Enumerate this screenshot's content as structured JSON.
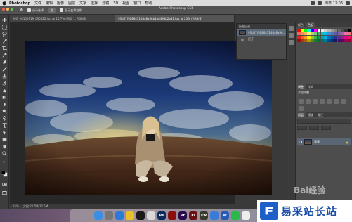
{
  "menubar": {
    "app_name": "Photoshop",
    "items": [
      "文件",
      "编辑",
      "图像",
      "图层",
      "文字",
      "选择",
      "滤镜",
      "3D",
      "视图",
      "窗口",
      "帮助"
    ],
    "clock": "周日 12:06"
  },
  "window": {
    "title": "Adobe Photoshop CS6"
  },
  "options_bar": {
    "auto_select_label": "自动选择:",
    "layer_select": "组",
    "show_transform_label": "显示变换控件"
  },
  "document_tabs": [
    {
      "label": "IMG_20150919_090522.jpg @ 16.7% (图层 1, RGB/8)",
      "active": false
    },
    {
      "label": "93d57f92864314da8a98b1a8494b2b31.jpg @ 25% (RGB/8)",
      "active": true
    }
  ],
  "status_bar": {
    "zoom": "25%",
    "doc_info": "文档:22.5M/22.5M"
  },
  "history_panel": {
    "title": "历史记录",
    "rows": [
      {
        "label": "93d57f92864314da8a98...",
        "selected": true
      },
      {
        "label": "打开",
        "selected": false
      }
    ]
  },
  "right_panel": {
    "swatch_tabs": [
      "颜色",
      "色板"
    ],
    "adjust_tabs": [
      "调整",
      "样式"
    ],
    "adjust_label": "添加调整",
    "layer_tabs": [
      "图层",
      "通道",
      "路径"
    ],
    "layer_name": "背景",
    "swatch_colors": [
      "#ff0000",
      "#ffff00",
      "#00ff00",
      "#00ffff",
      "#0000ff",
      "#ff00ff",
      "#ffffff",
      "#e6e6e6",
      "#cccccc",
      "#b3b3b3",
      "#999999",
      "#808080",
      "#666666",
      "#4d4d4d",
      "#333333",
      "#000000",
      "#f26c4f",
      "#f68e56",
      "#fbaf5d",
      "#fff467",
      "#acd372",
      "#7cc576",
      "#3bb878",
      "#1abbb4",
      "#00bff3",
      "#438ccb",
      "#5574b9",
      "#605ca8",
      "#855fa8",
      "#a763a8",
      "#f06ea9",
      "#f26d7d",
      "#ed1c24",
      "#f26522",
      "#f7941d",
      "#fff200",
      "#8dc63f",
      "#39b54a",
      "#00a651",
      "#00a99d",
      "#00aeef",
      "#0072bc",
      "#0054a6",
      "#2e3192",
      "#662d91",
      "#92278f",
      "#ec008c",
      "#ed145b",
      "#9e0b0f",
      "#a0410d",
      "#a36209",
      "#aba000",
      "#598527",
      "#1a7b30",
      "#007236",
      "#00746b",
      "#0076a3",
      "#004b80",
      "#003471",
      "#1b1464",
      "#440e62",
      "#630460",
      "#9e005d",
      "#9e0039"
    ]
  },
  "dock_apps": [
    {
      "name": "finder",
      "color": "#3a8ee6",
      "glyph": ""
    },
    {
      "name": "launchpad",
      "color": "#777777",
      "glyph": ""
    },
    {
      "name": "safari",
      "color": "#2a7ad8",
      "glyph": ""
    },
    {
      "name": "chrome",
      "color": "#e8c02c",
      "glyph": ""
    },
    {
      "name": "qq",
      "color": "#1a1a1a",
      "glyph": ""
    },
    {
      "name": "photos",
      "color": "#d8d8d8",
      "glyph": ""
    },
    {
      "name": "photoshop",
      "color": "#0a2a5a",
      "glyph": "Ps"
    },
    {
      "name": "acrobat",
      "color": "#8a1010",
      "glyph": ""
    },
    {
      "name": "premiere",
      "color": "#2a0a4a",
      "glyph": "Pr"
    },
    {
      "name": "flash",
      "color": "#6a1010",
      "glyph": "Fl"
    },
    {
      "name": "fireworks",
      "color": "#3a3a2a",
      "glyph": "Fw"
    },
    {
      "name": "app-store",
      "color": "#3a7ad8",
      "glyph": ""
    },
    {
      "name": "word",
      "color": "#2a5ab8",
      "glyph": "W"
    },
    {
      "name": "wechat",
      "color": "#2ab84a",
      "glyph": ""
    },
    {
      "name": "calendar",
      "color": "#eeeeee",
      "glyph": ""
    }
  ],
  "watermarks": {
    "baidu": "Bai经验",
    "site_name": "易采站长站"
  }
}
